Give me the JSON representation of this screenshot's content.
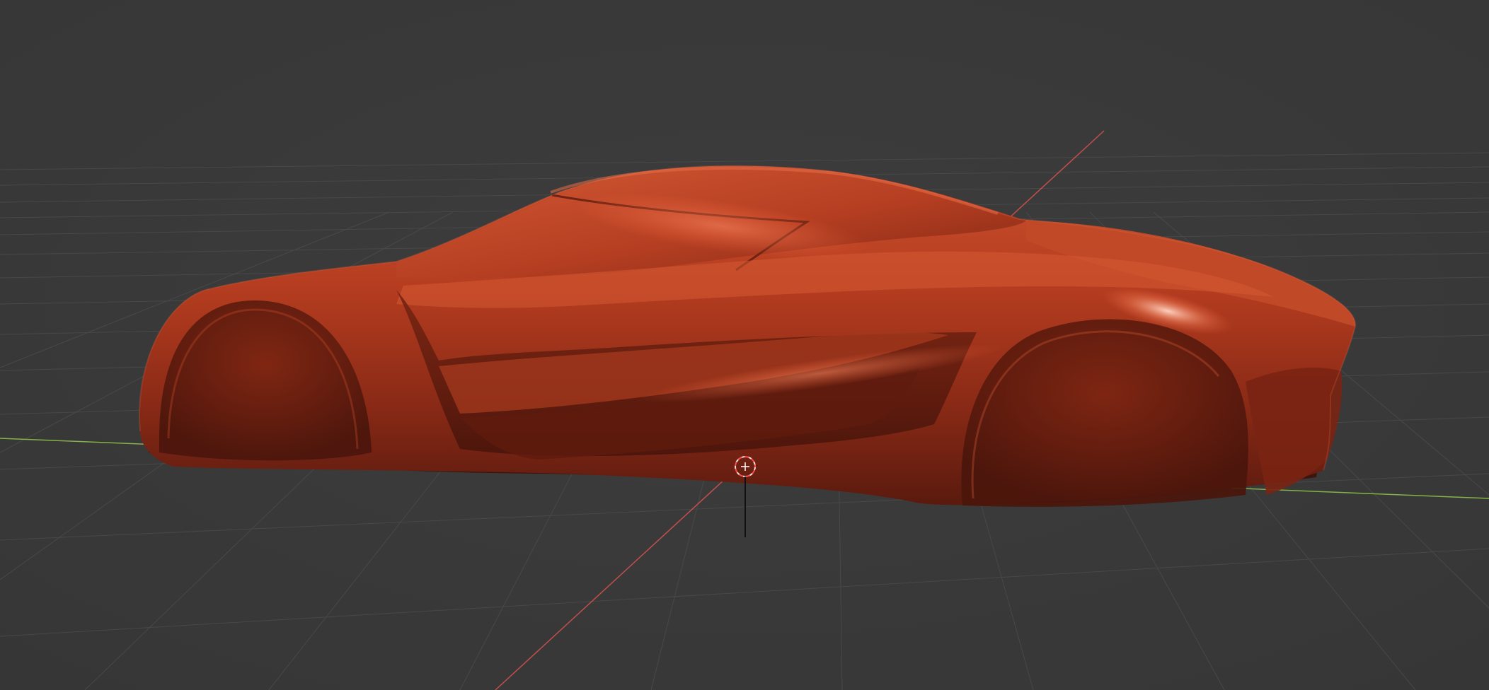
{
  "viewport": {
    "kind": "3d-viewport",
    "shading": "solid",
    "background_color": "#3a3a3a",
    "grid_color": "#4a4a4a",
    "x_axis_color": "#d9534f",
    "y_axis_color": "#8fbf4a",
    "model_color": "#b23a1e"
  },
  "objects": [
    {
      "name": "car-body",
      "type": "mesh"
    }
  ],
  "cursor": {
    "name": "3d-cursor"
  }
}
